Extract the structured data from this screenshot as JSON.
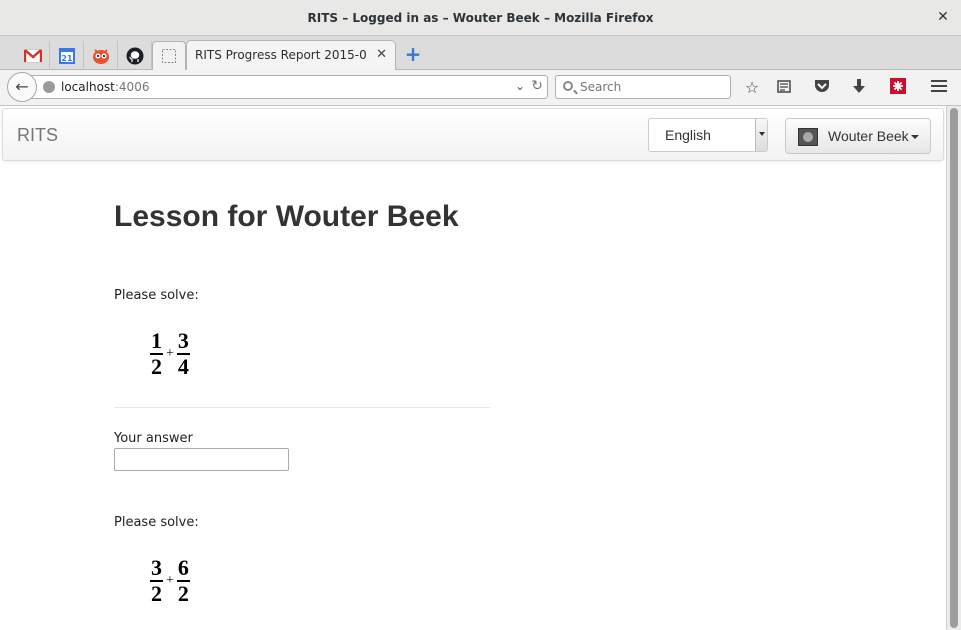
{
  "window": {
    "title": "RITS – Logged in as – Wouter Beek – Mozilla Firefox",
    "close_label": "✕"
  },
  "tabs": {
    "pinned": [
      {
        "name": "gmail-icon",
        "glyph": "M"
      },
      {
        "name": "calendar-icon",
        "glyph": "21"
      },
      {
        "name": "firefox-mascot-icon",
        "glyph": ""
      },
      {
        "name": "github-icon",
        "glyph": ""
      },
      {
        "name": "blank-tab-icon",
        "glyph": ""
      }
    ],
    "active_label": "RITS Progress Report 2015-0...",
    "close_glyph": "✕",
    "new_tab_glyph": "+"
  },
  "navbar": {
    "url_host": "localhost",
    "url_port": ":4006",
    "search_placeholder": "Search"
  },
  "app": {
    "brand": "RITS",
    "language": "English",
    "user_name": "Wouter Beek"
  },
  "lesson": {
    "title": "Lesson for Wouter Beek",
    "answer_label": "Your answer",
    "exercises": [
      {
        "prompt": "Please solve:",
        "a_num": "1",
        "a_den": "2",
        "op": "+",
        "b_num": "3",
        "b_den": "4"
      },
      {
        "prompt": "Please solve:",
        "a_num": "3",
        "a_den": "2",
        "op": "+",
        "b_num": "6",
        "b_den": "2"
      }
    ]
  }
}
